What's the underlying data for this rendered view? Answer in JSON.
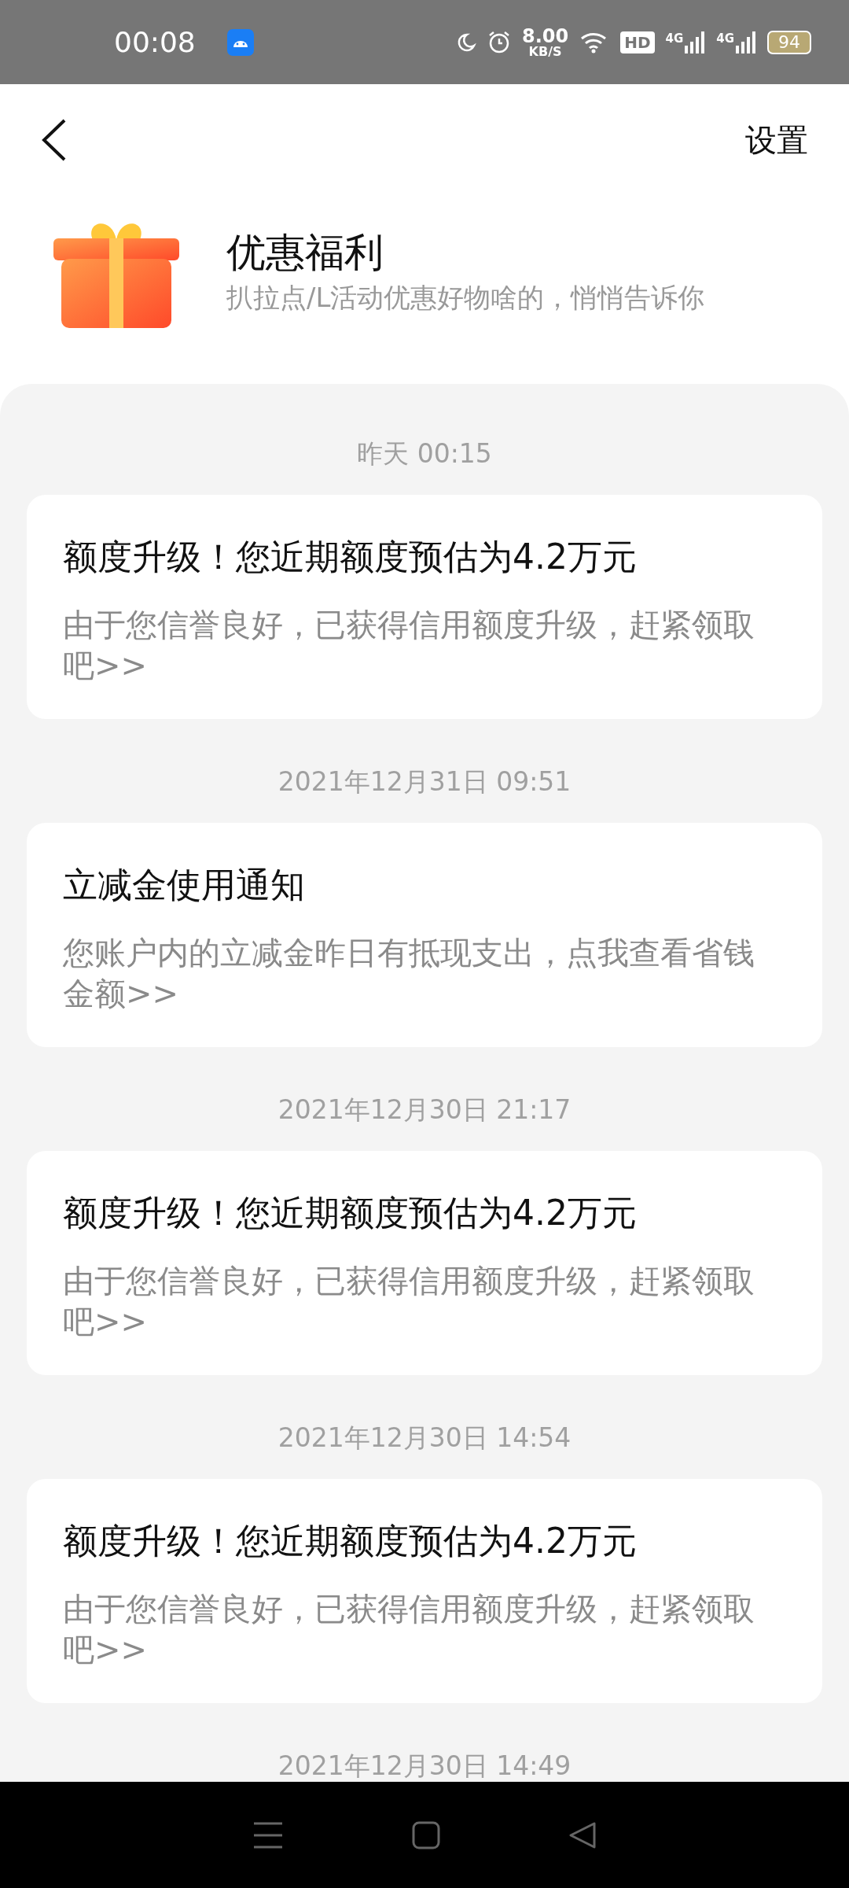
{
  "status_bar": {
    "time": "00:08",
    "speed_value": "8.00",
    "speed_unit": "KB/S",
    "hd_label": "HD",
    "networks": [
      {
        "label": "4G"
      },
      {
        "label": "4G"
      }
    ],
    "battery": "94"
  },
  "app_bar": {
    "settings": "设置"
  },
  "header": {
    "title": "优惠福利",
    "subtitle": "扒拉点/L活动优惠好物啥的，悄悄告诉你"
  },
  "messages": [
    {
      "time": "昨天 00:15",
      "title": "额度升级！您近期额度预估为4.2万元",
      "body": "由于您信誉良好，已获得信用额度升级，赶紧领取吧>>"
    },
    {
      "time": "2021年12月31日 09:51",
      "title": "立减金使用通知",
      "body": "您账户内的立减金昨日有抵现支出，点我查看省钱金额>>"
    },
    {
      "time": "2021年12月30日 21:17",
      "title": "额度升级！您近期额度预估为4.2万元",
      "body": "由于您信誉良好，已获得信用额度升级，赶紧领取吧>>"
    },
    {
      "time": "2021年12月30日 14:54",
      "title": "额度升级！您近期额度预估为4.2万元",
      "body": "由于您信誉良好，已获得信用额度升级，赶紧领取吧>>"
    },
    {
      "time": "2021年12月30日 14:49"
    }
  ]
}
